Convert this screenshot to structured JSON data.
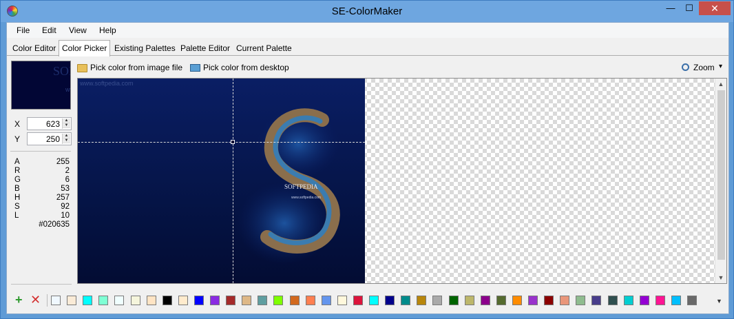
{
  "window": {
    "title": "SE-ColorMaker",
    "min_glyph": "—",
    "max_glyph": "☐",
    "close_glyph": "✕"
  },
  "menu": [
    "File",
    "Edit",
    "View",
    "Help"
  ],
  "tabs": [
    "Color Editor",
    "Color Picker",
    "Existing Palettes",
    "Palette Editor",
    "Current Palette"
  ],
  "active_tab": 1,
  "preview": {
    "watermark": "SOFT",
    "watermark_small": "www.softpedia.com",
    "color": "#020635"
  },
  "coords": {
    "x_label": "X",
    "x_value": "623",
    "y_label": "Y",
    "y_value": "250"
  },
  "info": [
    {
      "k": "A",
      "v": "255"
    },
    {
      "k": "R",
      "v": "2"
    },
    {
      "k": "G",
      "v": "6"
    },
    {
      "k": "B",
      "v": "53"
    },
    {
      "k": "H",
      "v": "257"
    },
    {
      "k": "S",
      "v": "92"
    },
    {
      "k": "L",
      "v": "10"
    },
    {
      "k": "",
      "v": "#020635"
    }
  ],
  "toolbar": {
    "pick_image": "Pick color from image file",
    "pick_desktop": "Pick color from desktop",
    "zoom": "Zoom",
    "zoom_arrow": "▾"
  },
  "image": {
    "watermark": "www.softpedia.com",
    "softpedia": "SOFTPEDIA",
    "softpedia_url": "www.softpedia.com"
  },
  "scroll": {
    "up": "▲",
    "down": "▼"
  },
  "palette": {
    "add": "+",
    "delete": "✕",
    "dropdown": "▼",
    "swatches": [
      "#f0f8ff",
      "#faebd7",
      "#00ffff",
      "#7fffd4",
      "#f0ffff",
      "#f5f5dc",
      "#ffe4c4",
      "#000000",
      "#ffebcd",
      "#0000ff",
      "#8a2be2",
      "#a52a2a",
      "#deb887",
      "#5f9ea0",
      "#7fff00",
      "#d2691e",
      "#ff7f50",
      "#6495ed",
      "#fff8dc",
      "#dc143c",
      "#00ffff",
      "#00008b",
      "#008b8b",
      "#b8860b",
      "#a9a9a9",
      "#006400",
      "#bdb76b",
      "#8b008b",
      "#556b2f",
      "#ff8c00",
      "#9932cc",
      "#8b0000",
      "#e9967a",
      "#8fbc8f",
      "#483d8b",
      "#2f4f4f",
      "#00ced1",
      "#9400d3",
      "#ff1493",
      "#00bfff",
      "#696969"
    ]
  }
}
